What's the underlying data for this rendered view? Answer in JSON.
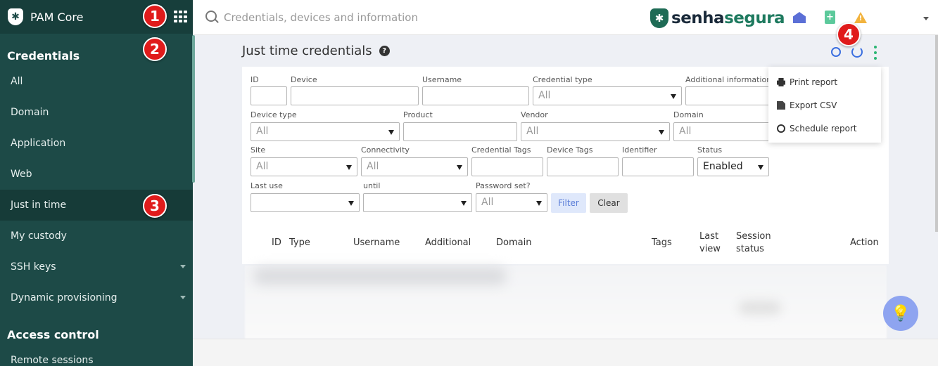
{
  "app": {
    "name": "PAM Core"
  },
  "search": {
    "placeholder": "Credentials, devices and information"
  },
  "brand": {
    "part1": "senha",
    "part2": "segura"
  },
  "sidebar": {
    "section1": "Credentials",
    "items": [
      {
        "label": "All"
      },
      {
        "label": "Domain"
      },
      {
        "label": "Application"
      },
      {
        "label": "Web"
      },
      {
        "label": "Just in time"
      },
      {
        "label": "My custody"
      },
      {
        "label": "SSH keys"
      },
      {
        "label": "Dynamic provisioning"
      }
    ],
    "section2": "Access control",
    "items2": [
      {
        "label": "Remote sessions"
      }
    ]
  },
  "badges": [
    "1",
    "2",
    "3",
    "4"
  ],
  "page": {
    "title": "Just time credentials"
  },
  "filters": {
    "id": "ID",
    "device": "Device",
    "username": "Username",
    "credential_type": "Credential type",
    "credential_type_value": "All",
    "additional_info": "Additional information",
    "device_type": "Device type",
    "device_type_value": "All",
    "product": "Product",
    "vendor": "Vendor",
    "vendor_value": "All",
    "domain": "Domain",
    "domain_value": "All",
    "site": "Site",
    "site_value": "All",
    "connectivity": "Connectivity",
    "connectivity_value": "All",
    "credential_tags": "Credential Tags",
    "device_tags": "Device Tags",
    "identifier": "Identifier",
    "status": "Status",
    "status_value": "Enabled",
    "last_use": "Last use",
    "until": "until",
    "password_set": "Password set?",
    "password_set_value": "All",
    "filter_btn": "Filter",
    "clear_btn": "Clear"
  },
  "table": {
    "headers": {
      "id": "ID",
      "type": "Type",
      "username": "Username",
      "additional": "Additional",
      "domain": "Domain",
      "tags": "Tags",
      "last_view": "Last view",
      "session_status": "Session status",
      "action": "Action"
    }
  },
  "menu": {
    "print": "Print report",
    "export": "Export CSV",
    "schedule": "Schedule report"
  }
}
